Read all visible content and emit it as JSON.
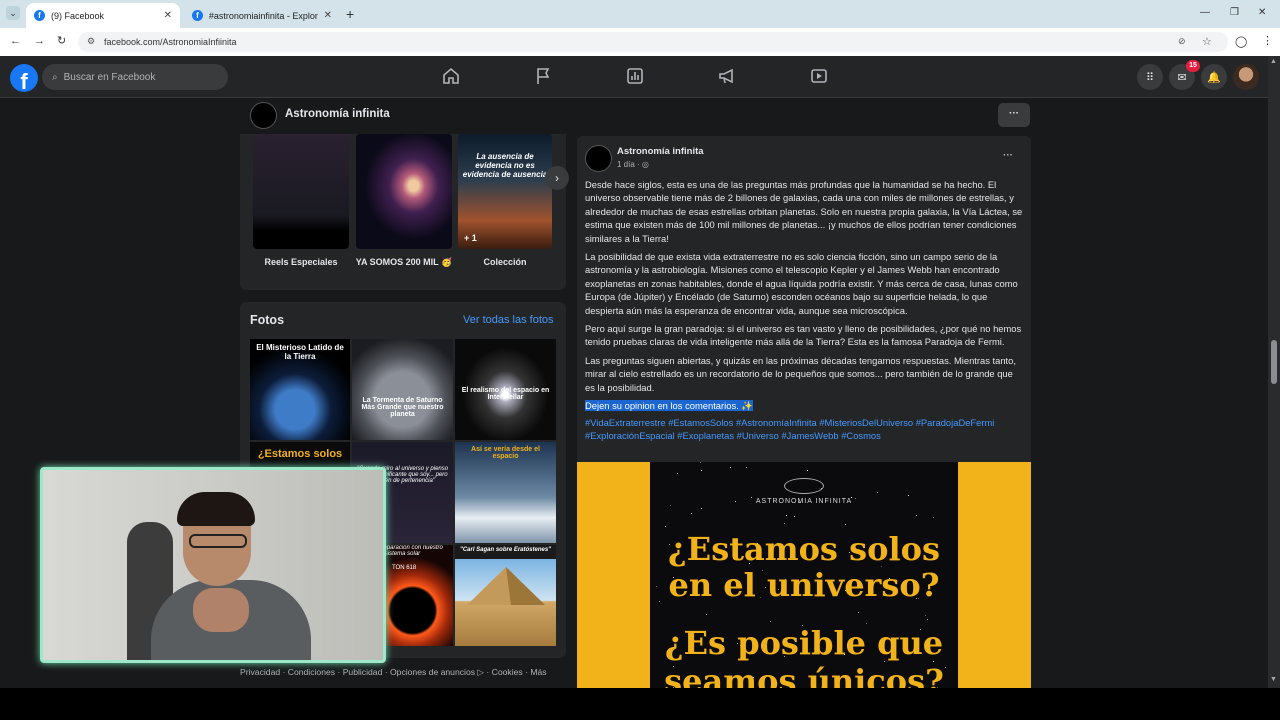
{
  "browser": {
    "tabs": [
      {
        "title": "(9) Facebook",
        "active": true
      },
      {
        "title": "#astronomiainfinita - Explorar",
        "active": false
      }
    ],
    "url": "facebook.com/AstronomiaInfiinita"
  },
  "fb": {
    "search_placeholder": "Buscar en Facebook",
    "notification_count": "15"
  },
  "page": {
    "name": "Astronomía infinita",
    "more_label": "···"
  },
  "featured": {
    "items": [
      {
        "label": "Reels Especiales"
      },
      {
        "label": "YA SOMOS 200 MIL 🥳"
      },
      {
        "label": "Colección",
        "overlay": "La ausencia de evidencia no es evidencia de ausencia",
        "count": "+ 1"
      }
    ]
  },
  "photos": {
    "title": "Fotos",
    "see_all": "Ver todas las fotos",
    "captions": [
      "El Misterioso Latido de la Tierra",
      "La Tormenta de Saturno Más Grande que nuestro planeta",
      "El realismo del espacio en Interstellar",
      "¿Estamos solos",
      "\"Cuando miro al universo y pienso en lo insignificante que soy... pero también de pertenencia\"",
      "Así se vería desde el espacio",
      "...en comparación con nuestro sistema solar",
      "TON 618",
      "\"Carl Sagan sobre Eratóstenes\""
    ]
  },
  "footer_links": "Privacidad · Condiciones · Publicidad · Opciones de anuncios ▷ · Cookies · Más",
  "post": {
    "author": "Astronomía infinita",
    "time": "1 día · ",
    "menu": "···",
    "paragraphs": [
      "Desde hace siglos, esta es una de las preguntas más profundas que la humanidad se ha hecho. El universo observable tiene más de 2 billones de galaxias, cada una con miles de millones de estrellas, y alrededor de muchas de esas estrellas orbitan planetas. Solo en nuestra propia galaxia, la Vía Láctea, se estima que existen más de 100 mil millones de planetas... ¡y muchos de ellos podrían tener condiciones similares a la Tierra!",
      "La posibilidad de que exista vida extraterrestre no es solo ciencia ficción, sino un campo serio de la astronomía y la astrobiología. Misiones como el telescopio Kepler y el James Webb han encontrado exoplanetas en zonas habitables, donde el agua líquida podría existir. Y más cerca de casa, lunas como Europa (de Júpiter) y Encélado (de Saturno) esconden océanos bajo su superficie helada, lo que despierta aún más la esperanza de encontrar vida, aunque sea microscópica.",
      "Pero aquí surge la gran paradoja: si el universo es tan vasto y lleno de posibilidades, ¿por qué no hemos tenido pruebas claras de vida inteligente más allá de la Tierra? Esta es la famosa Paradoja de Fermi.",
      "Las preguntas siguen abiertas, y quizás en las próximas décadas tengamos respuestas. Mientras tanto, mirar al cielo estrellado es un recordatorio de lo pequeños que somos... pero también de lo grande que es la posibilidad."
    ],
    "highlight": "Dejen su opinion en los comentarios. ✨",
    "hashtags": "#VidaExtraterrestre #EstamosSolos #AstronomíaInfinita #MisteriosDelUniverso #ParadojaDeFermi #ExploraciónEspacial #Exoplanetas #Universo #JamesWebb #Cosmos",
    "image": {
      "brand": "ASTRONOMIA INFINITA",
      "line1": "¿Estamos solos",
      "line2": "en el universo?",
      "line3": "¿Es posible que",
      "line4": "seamos únicos?"
    }
  },
  "colors": {
    "fb_blue": "#1877f2",
    "poster_yellow": "#f2b21a",
    "link": "#4599ff"
  }
}
